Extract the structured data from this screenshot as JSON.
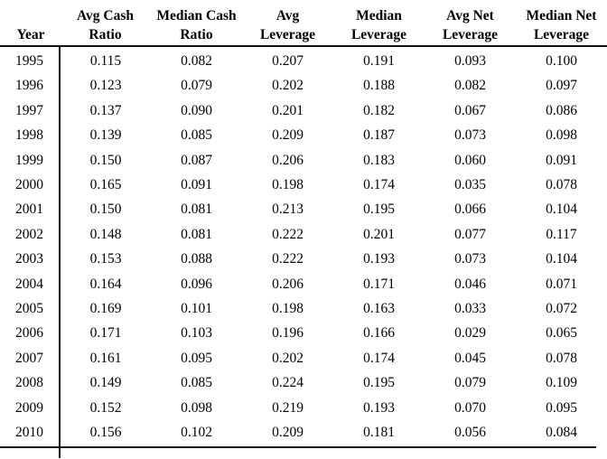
{
  "table": {
    "columns": [
      {
        "id": "year",
        "label": "Year"
      },
      {
        "id": "avg_cash_ratio",
        "label": "Avg Cash\nRatio"
      },
      {
        "id": "median_cash_ratio",
        "label": "Median Cash\nRatio"
      },
      {
        "id": "avg_leverage",
        "label": "Avg\nLeverage"
      },
      {
        "id": "median_leverage",
        "label": "Median\nLeverage"
      },
      {
        "id": "avg_net_leverage",
        "label": "Avg Net\nLeverage"
      },
      {
        "id": "median_net_leverage",
        "label": "Median Net\nLeverage"
      }
    ],
    "rows": [
      {
        "year": "1995",
        "avg_cash_ratio": "0.115",
        "median_cash_ratio": "0.082",
        "avg_leverage": "0.207",
        "median_leverage": "0.191",
        "avg_net_leverage": "0.093",
        "median_net_leverage": "0.100"
      },
      {
        "year": "1996",
        "avg_cash_ratio": "0.123",
        "median_cash_ratio": "0.079",
        "avg_leverage": "0.202",
        "median_leverage": "0.188",
        "avg_net_leverage": "0.082",
        "median_net_leverage": "0.097"
      },
      {
        "year": "1997",
        "avg_cash_ratio": "0.137",
        "median_cash_ratio": "0.090",
        "avg_leverage": "0.201",
        "median_leverage": "0.182",
        "avg_net_leverage": "0.067",
        "median_net_leverage": "0.086"
      },
      {
        "year": "1998",
        "avg_cash_ratio": "0.139",
        "median_cash_ratio": "0.085",
        "avg_leverage": "0.209",
        "median_leverage": "0.187",
        "avg_net_leverage": "0.073",
        "median_net_leverage": "0.098"
      },
      {
        "year": "1999",
        "avg_cash_ratio": "0.150",
        "median_cash_ratio": "0.087",
        "avg_leverage": "0.206",
        "median_leverage": "0.183",
        "avg_net_leverage": "0.060",
        "median_net_leverage": "0.091"
      },
      {
        "year": "2000",
        "avg_cash_ratio": "0.165",
        "median_cash_ratio": "0.091",
        "avg_leverage": "0.198",
        "median_leverage": "0.174",
        "avg_net_leverage": "0.035",
        "median_net_leverage": "0.078"
      },
      {
        "year": "2001",
        "avg_cash_ratio": "0.150",
        "median_cash_ratio": "0.081",
        "avg_leverage": "0.213",
        "median_leverage": "0.195",
        "avg_net_leverage": "0.066",
        "median_net_leverage": "0.104"
      },
      {
        "year": "2002",
        "avg_cash_ratio": "0.148",
        "median_cash_ratio": "0.081",
        "avg_leverage": "0.222",
        "median_leverage": "0.201",
        "avg_net_leverage": "0.077",
        "median_net_leverage": "0.117"
      },
      {
        "year": "2003",
        "avg_cash_ratio": "0.153",
        "median_cash_ratio": "0.088",
        "avg_leverage": "0.222",
        "median_leverage": "0.193",
        "avg_net_leverage": "0.073",
        "median_net_leverage": "0.104"
      },
      {
        "year": "2004",
        "avg_cash_ratio": "0.164",
        "median_cash_ratio": "0.096",
        "avg_leverage": "0.206",
        "median_leverage": "0.171",
        "avg_net_leverage": "0.046",
        "median_net_leverage": "0.071"
      },
      {
        "year": "2005",
        "avg_cash_ratio": "0.169",
        "median_cash_ratio": "0.101",
        "avg_leverage": "0.198",
        "median_leverage": "0.163",
        "avg_net_leverage": "0.033",
        "median_net_leverage": "0.072"
      },
      {
        "year": "2006",
        "avg_cash_ratio": "0.171",
        "median_cash_ratio": "0.103",
        "avg_leverage": "0.196",
        "median_leverage": "0.166",
        "avg_net_leverage": "0.029",
        "median_net_leverage": "0.065"
      },
      {
        "year": "2007",
        "avg_cash_ratio": "0.161",
        "median_cash_ratio": "0.095",
        "avg_leverage": "0.202",
        "median_leverage": "0.174",
        "avg_net_leverage": "0.045",
        "median_net_leverage": "0.078"
      },
      {
        "year": "2008",
        "avg_cash_ratio": "0.149",
        "median_cash_ratio": "0.085",
        "avg_leverage": "0.224",
        "median_leverage": "0.195",
        "avg_net_leverage": "0.079",
        "median_net_leverage": "0.109"
      },
      {
        "year": "2009",
        "avg_cash_ratio": "0.152",
        "median_cash_ratio": "0.098",
        "avg_leverage": "0.219",
        "median_leverage": "0.193",
        "avg_net_leverage": "0.070",
        "median_net_leverage": "0.095"
      },
      {
        "year": "2010",
        "avg_cash_ratio": "0.156",
        "median_cash_ratio": "0.102",
        "avg_leverage": "0.209",
        "median_leverage": "0.181",
        "avg_net_leverage": "0.056",
        "median_net_leverage": "0.084"
      }
    ]
  },
  "style": {
    "rule_color": "#111111",
    "text_color": "#000000",
    "background": "#ffffff"
  }
}
